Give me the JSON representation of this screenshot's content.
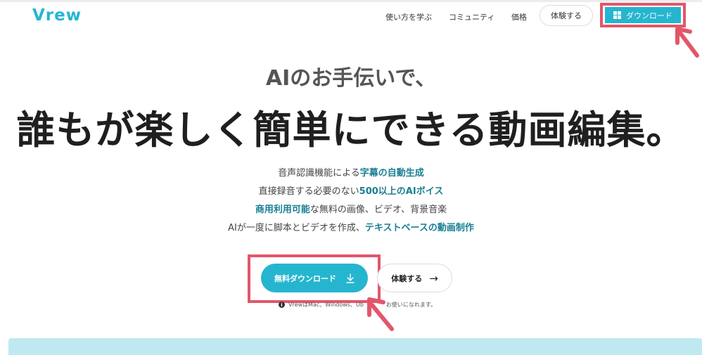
{
  "header": {
    "logo": "Vrew",
    "nav": {
      "learn": "使い方を学ぶ",
      "community": "コミュニティ",
      "price": "価格",
      "try": "体験する",
      "download": "ダウンロード"
    }
  },
  "hero": {
    "subtitle": "AIのお手伝いで、",
    "headline": "誰もが楽しく簡単にできる動画編集。",
    "features": [
      {
        "pre": "音声認識機能による",
        "strong": "字幕の自動生成",
        "post": ""
      },
      {
        "pre": "直接録音する必要のない",
        "strong": "500以上のAIボイス",
        "post": ""
      },
      {
        "pre": "",
        "strong": "商用利用可能",
        "post": "な無料の画像、ビデオ、背景音楽"
      },
      {
        "pre": "AIが一度に脚本とビデオを作成、",
        "strong": "テキストベースの動画制作",
        "post": ""
      }
    ],
    "cta_download": "無料ダウンロード",
    "cta_try": "体験する",
    "note": "VrewはMac、Windows、Ub",
    "note_tail": "お使いになれます。"
  },
  "colors": {
    "brand": "#26b5cf",
    "highlight": "#e2566a",
    "accent_text": "#1a7f93",
    "band": "#bfe9f1"
  },
  "icons": {
    "windows": "windows-icon",
    "download": "download-icon",
    "arrow": "arrow-right-icon",
    "info": "info-icon"
  }
}
